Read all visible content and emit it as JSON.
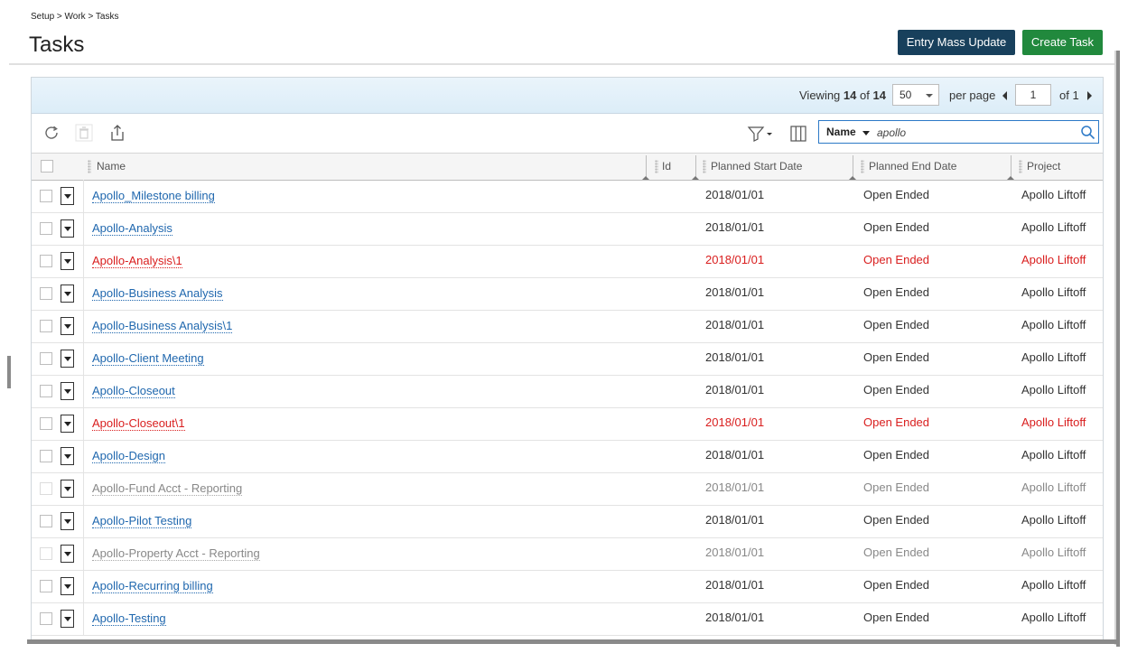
{
  "breadcrumb": "Setup > Work > Tasks",
  "page_title": "Tasks",
  "buttons": {
    "entry_mass_update": "Entry Mass Update",
    "create_task": "Create Task"
  },
  "pager": {
    "viewing_label": "Viewing",
    "viewing_count": "14",
    "of_label": "of",
    "total": "14",
    "per_page_value": "50",
    "per_page_label": "per page",
    "page_value": "1",
    "page_of": "of 1"
  },
  "search": {
    "field": "Name",
    "value": "apollo"
  },
  "columns": {
    "name": "Name",
    "id": "Id",
    "planned_start": "Planned Start Date",
    "planned_end": "Planned End Date",
    "project": "Project"
  },
  "rows": [
    {
      "name": "Apollo_Milestone billing",
      "start": "2018/01/01",
      "end": "Open Ended",
      "project": "Apollo Liftoff",
      "status": "normal"
    },
    {
      "name": "Apollo-Analysis",
      "start": "2018/01/01",
      "end": "Open Ended",
      "project": "Apollo Liftoff",
      "status": "normal"
    },
    {
      "name": "Apollo-Analysis\\1",
      "start": "2018/01/01",
      "end": "Open Ended",
      "project": "Apollo Liftoff",
      "status": "red"
    },
    {
      "name": "Apollo-Business Analysis",
      "start": "2018/01/01",
      "end": "Open Ended",
      "project": "Apollo Liftoff",
      "status": "normal"
    },
    {
      "name": "Apollo-Business Analysis\\1",
      "start": "2018/01/01",
      "end": "Open Ended",
      "project": "Apollo Liftoff",
      "status": "normal"
    },
    {
      "name": "Apollo-Client Meeting",
      "start": "2018/01/01",
      "end": "Open Ended",
      "project": "Apollo Liftoff",
      "status": "normal"
    },
    {
      "name": "Apollo-Closeout",
      "start": "2018/01/01",
      "end": "Open Ended",
      "project": "Apollo Liftoff",
      "status": "normal"
    },
    {
      "name": "Apollo-Closeout\\1",
      "start": "2018/01/01",
      "end": "Open Ended",
      "project": "Apollo Liftoff",
      "status": "red"
    },
    {
      "name": "Apollo-Design",
      "start": "2018/01/01",
      "end": "Open Ended",
      "project": "Apollo Liftoff",
      "status": "normal"
    },
    {
      "name": "Apollo-Fund Acct - Reporting",
      "start": "2018/01/01",
      "end": "Open Ended",
      "project": "Apollo Liftoff",
      "status": "gray"
    },
    {
      "name": "Apollo-Pilot Testing",
      "start": "2018/01/01",
      "end": "Open Ended",
      "project": "Apollo Liftoff",
      "status": "normal"
    },
    {
      "name": "Apollo-Property Acct - Reporting",
      "start": "2018/01/01",
      "end": "Open Ended",
      "project": "Apollo Liftoff",
      "status": "gray"
    },
    {
      "name": "Apollo-Recurring billing",
      "start": "2018/01/01",
      "end": "Open Ended",
      "project": "Apollo Liftoff",
      "status": "normal"
    },
    {
      "name": "Apollo-Testing",
      "start": "2018/01/01",
      "end": "Open Ended",
      "project": "Apollo Liftoff",
      "status": "normal"
    }
  ],
  "icons": {
    "refresh": "refresh-icon",
    "delete": "trash-icon",
    "export": "export-icon",
    "filter": "filter-icon",
    "columns": "columns-icon",
    "search": "search-icon"
  },
  "colors": {
    "primary_button": "#18405c",
    "create_button": "#21893d",
    "link": "#1f67ae",
    "error": "#d91e1e",
    "inactive": "#888888"
  }
}
